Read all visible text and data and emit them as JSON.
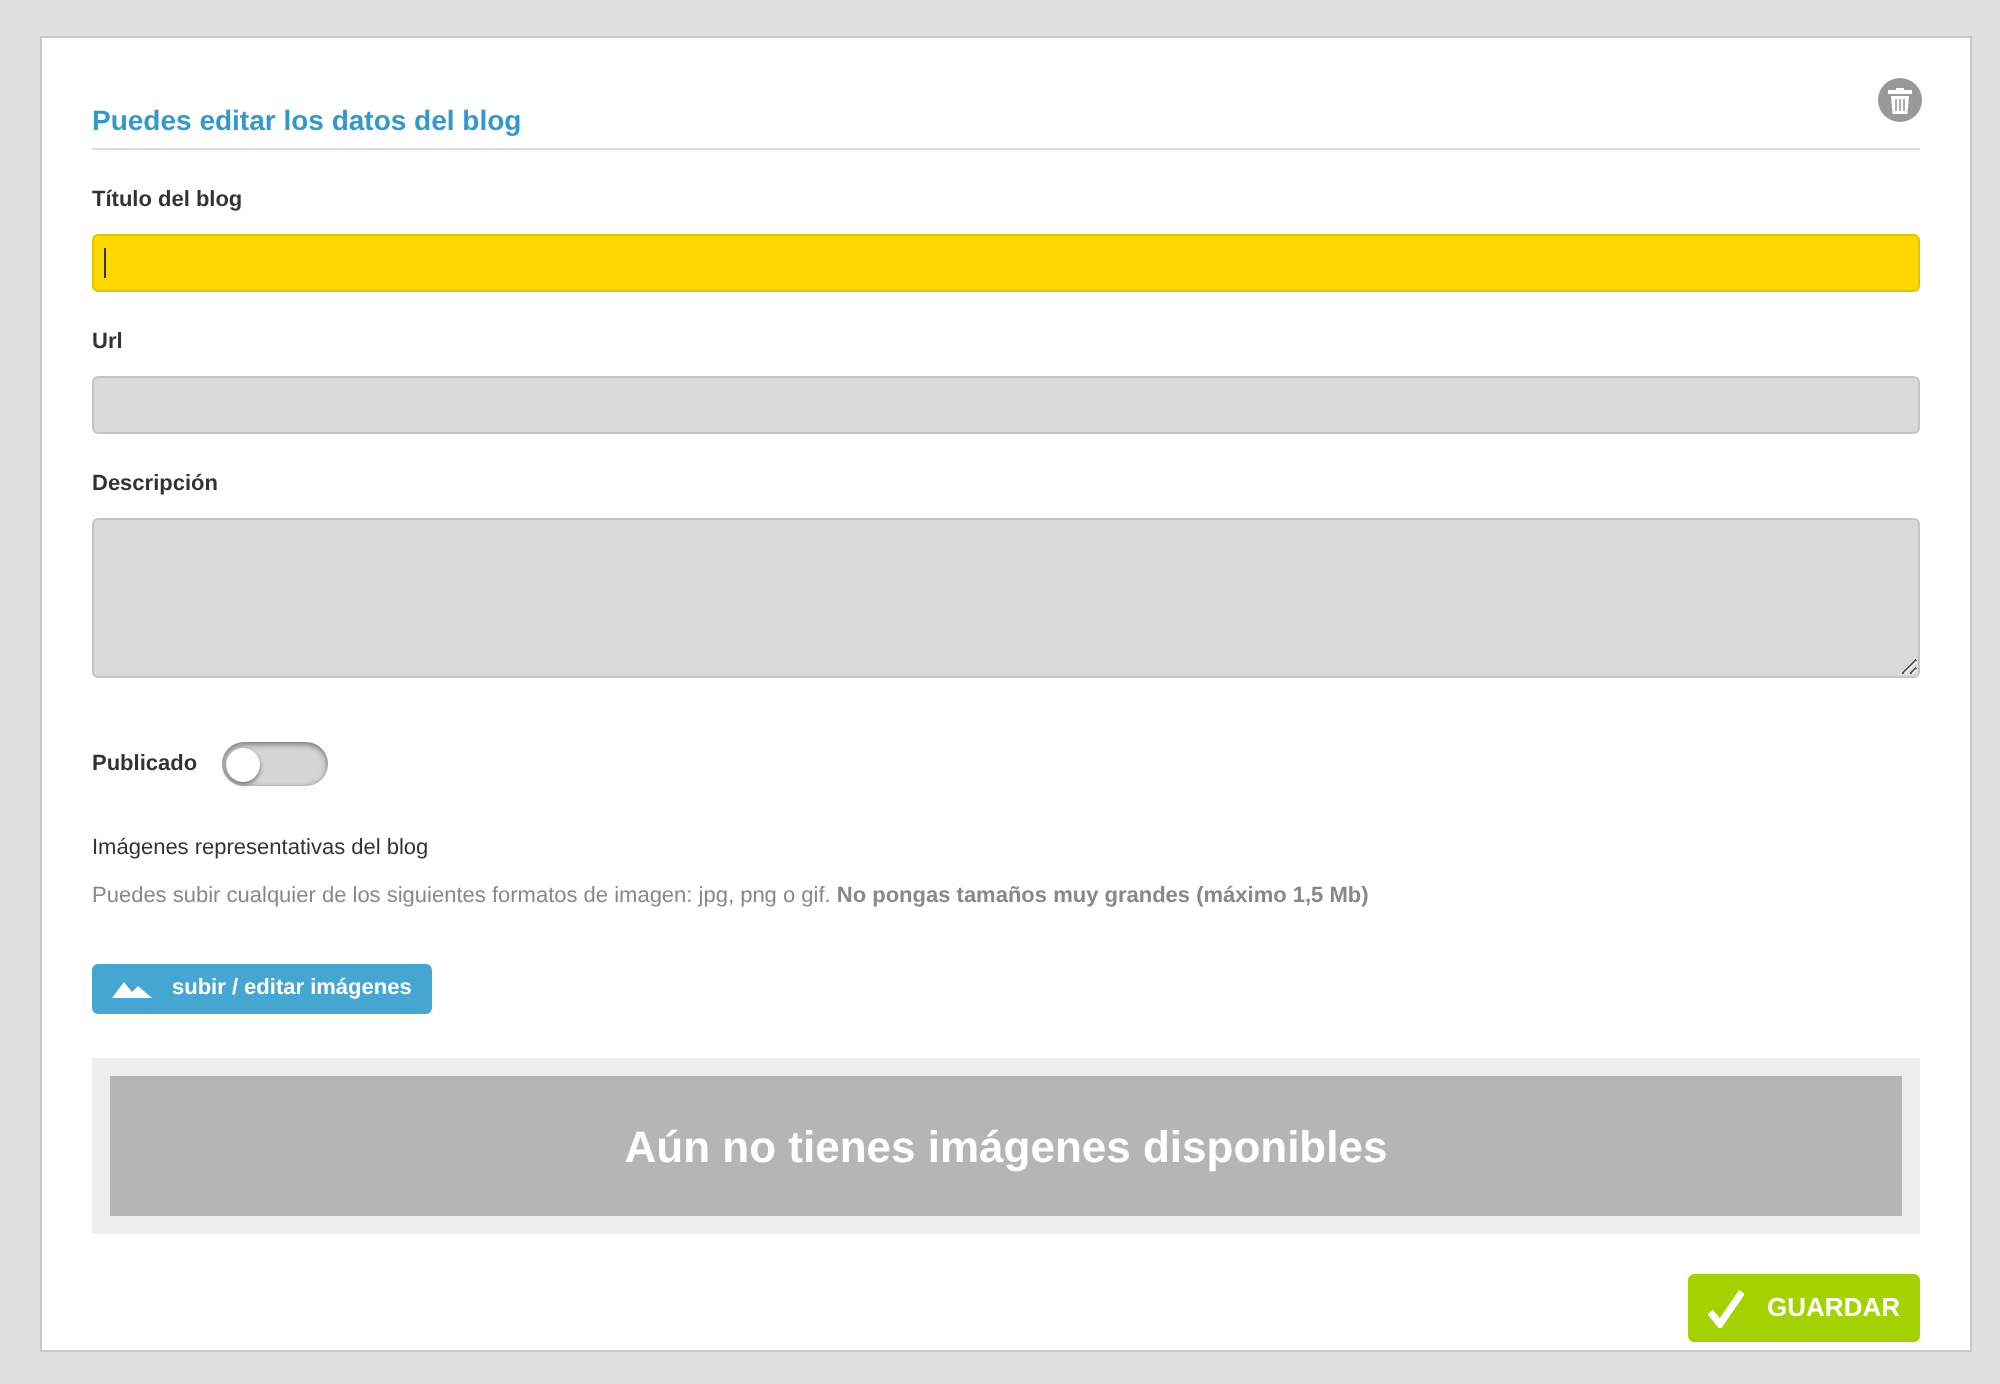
{
  "heading": "Puedes editar los datos del blog",
  "fields": [
    {
      "label": "Título del blog",
      "kind": "input",
      "focused": true
    },
    {
      "label": "Url",
      "kind": "input",
      "focused": false
    },
    {
      "label": "Descripción",
      "kind": "textarea",
      "focused": false
    }
  ],
  "published": {
    "label": "Publicado",
    "on": false
  },
  "images": {
    "title": "Imágenes representativas del blog",
    "hint": "Puedes subir cualquier de los siguientes formatos de imagen: jpg, png o gif. **No pongas tamaños muy grandes (máximo 1,5 Mb)**",
    "upload_button": "subir / editar imágenes",
    "empty_message": "Aún no tienes imágenes disponibles"
  },
  "save_button": "GUARDAR"
}
